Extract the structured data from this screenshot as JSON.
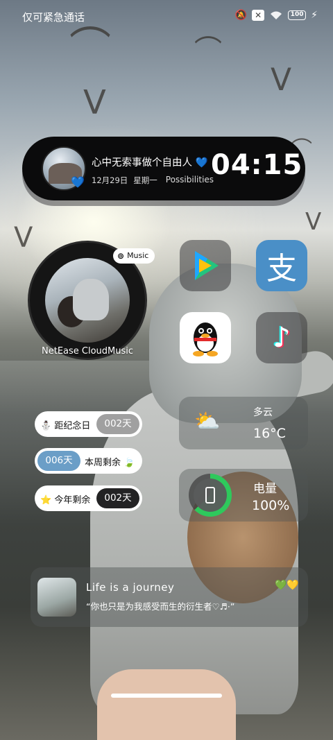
{
  "status_bar": {
    "carrier_text": "仅可紧急通话",
    "icons": [
      "mute-icon",
      "no-sim-icon",
      "wifi-icon",
      "battery-icon",
      "charging-icon"
    ],
    "battery_text": "100"
  },
  "pill_widget": {
    "title": "心中无索事做个自由人",
    "title_emoji": "💙",
    "date": "12月29日",
    "weekday": "星期一",
    "tagline": "Possibilities",
    "time": "04:15",
    "avatar_badge": "💙"
  },
  "music_widget": {
    "tag": "Music",
    "app_name": "NetEase CloudMusic"
  },
  "apps": [
    {
      "name": "Tencent Video",
      "icon": "tencent-video-icon"
    },
    {
      "name": "Alipay",
      "icon": "alipay-icon",
      "glyph": "支"
    },
    {
      "name": "QQ",
      "icon": "qq-penguin-icon"
    },
    {
      "name": "Douyin",
      "icon": "douyin-icon",
      "glyph": "♪"
    }
  ],
  "counters": [
    {
      "emoji": "⛄",
      "label": "距纪念日",
      "value": "002天"
    },
    {
      "value": "006天",
      "label": "本周剩余",
      "emoji": "🍃"
    },
    {
      "emoji": "⭐",
      "label": "今年剩余",
      "value": "002天"
    }
  ],
  "weather": {
    "condition": "多云",
    "temperature": "16°C",
    "icon": "partly-cloudy-icon"
  },
  "battery_widget": {
    "label": "电量",
    "value": "100%",
    "level": 1.0
  },
  "quote_widget": {
    "title": "Life is a journey",
    "text": "“你也只是为我感受而生的衍生者♡♬·”",
    "hearts": "💚💛"
  },
  "colors": {
    "battery_ring": "#2ec95c",
    "alipay": "#4a8fc7",
    "counter_week": "#6b9ec7"
  }
}
